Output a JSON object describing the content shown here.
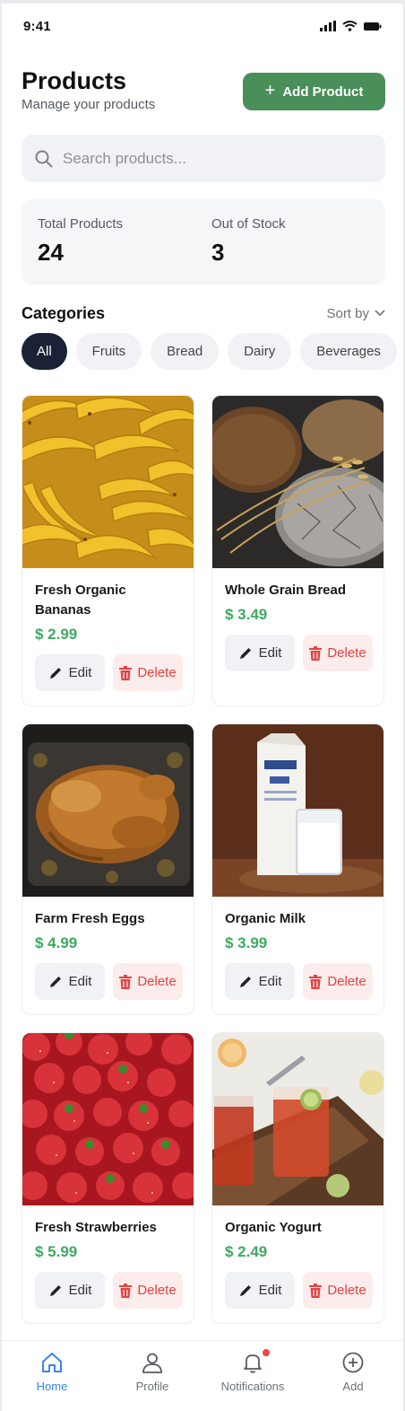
{
  "status_bar": {
    "time": "9:41"
  },
  "header": {
    "title": "Products",
    "subtitle": "Manage your products",
    "add_button_label": "Add Product"
  },
  "search": {
    "placeholder": "Search products..."
  },
  "stats": [
    {
      "label": "Total Products",
      "value": "24"
    },
    {
      "label": "Out of Stock",
      "value": "3"
    }
  ],
  "categories": {
    "title": "Categories",
    "sort_label": "Sort by",
    "chips": [
      "All",
      "Fruits",
      "Bread",
      "Dairy",
      "Beverages"
    ],
    "active": "All"
  },
  "products": [
    {
      "name": "Fresh Organic Bananas",
      "price": "$ 2.99",
      "edit": "Edit",
      "delete": "Delete",
      "image": "bananas"
    },
    {
      "name": "Whole Grain Bread",
      "price": "$ 3.49",
      "edit": "Edit",
      "delete": "Delete",
      "image": "bread"
    },
    {
      "name": "Farm Fresh Eggs",
      "price": "$ 4.99",
      "edit": "Edit",
      "delete": "Delete",
      "image": "roast-chicken"
    },
    {
      "name": "Organic Milk",
      "price": "$ 3.99",
      "edit": "Edit",
      "delete": "Delete",
      "image": "milk-carton"
    },
    {
      "name": "Fresh Strawberries",
      "price": "$ 5.99",
      "edit": "Edit",
      "delete": "Delete",
      "image": "strawberries"
    },
    {
      "name": "Organic Yogurt",
      "price": "$ 2.49",
      "edit": "Edit",
      "delete": "Delete",
      "image": "iced-tea"
    }
  ],
  "tabbar": [
    {
      "label": "Home",
      "icon": "home-icon",
      "active": true
    },
    {
      "label": "Profile",
      "icon": "user-icon",
      "active": false
    },
    {
      "label": "Notifications",
      "icon": "bell-icon",
      "active": false,
      "badge": true
    },
    {
      "label": "Add",
      "icon": "plus-circle-icon",
      "active": false
    }
  ],
  "colors": {
    "accent_green": "#4a8f59",
    "price_green": "#3daa5f",
    "chip_active": "#1b2236",
    "delete_red": "#e04444",
    "tab_active": "#3b82f6"
  }
}
